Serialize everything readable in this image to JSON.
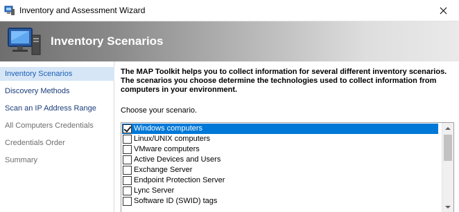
{
  "window": {
    "title": "Inventory and Assessment Wizard"
  },
  "banner": {
    "heading": "Inventory Scenarios"
  },
  "nav": {
    "items": [
      {
        "label": "Inventory Scenarios",
        "state": "active"
      },
      {
        "label": "Discovery Methods",
        "state": "enabled"
      },
      {
        "label": "Scan an IP Address Range",
        "state": "enabled"
      },
      {
        "label": "All Computers Credentials",
        "state": "disabled"
      },
      {
        "label": "Credentials Order",
        "state": "disabled"
      },
      {
        "label": "Summary",
        "state": "disabled"
      }
    ]
  },
  "main": {
    "intro": "The MAP Toolkit helps you to collect information for several different inventory scenarios. The scenarios you choose determine the technologies used to collect information from computers in your environment.",
    "prompt": "Choose your scenario.",
    "scenarios": [
      {
        "label": "Windows computers",
        "checked": true,
        "selected": true
      },
      {
        "label": "Linux/UNIX computers",
        "checked": false,
        "selected": false
      },
      {
        "label": "VMware computers",
        "checked": false,
        "selected": false
      },
      {
        "label": "Active Devices and Users",
        "checked": false,
        "selected": false
      },
      {
        "label": "Exchange Server",
        "checked": false,
        "selected": false
      },
      {
        "label": "Endpoint Protection Server",
        "checked": false,
        "selected": false
      },
      {
        "label": "Lync Server",
        "checked": false,
        "selected": false
      },
      {
        "label": "Software ID (SWID) tags",
        "checked": false,
        "selected": false
      }
    ]
  },
  "colors": {
    "selection": "#0078d7",
    "nav_active_bg": "#d6e6f7",
    "nav_link": "#1a3c7a",
    "nav_disabled": "#6d6d6d"
  }
}
